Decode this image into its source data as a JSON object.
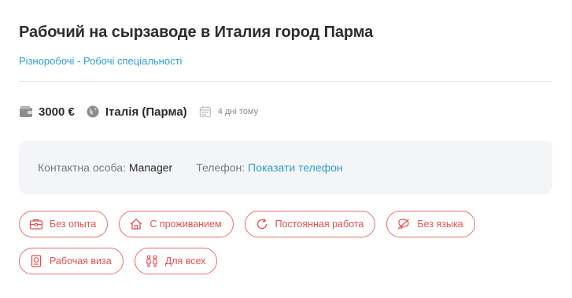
{
  "job": {
    "title": "Рабочий на сырзаводе в Италия город Парма",
    "category": "Різноробочі - Робочі спеціальності"
  },
  "meta": {
    "salary": "3000 €",
    "location": "Італія (Парма)",
    "posted": "4 дні тому",
    "icons": [
      "wallet-icon",
      "globe-icon",
      "calendar-icon"
    ]
  },
  "contact": {
    "person_label": "Контактна особа:",
    "person_value": "Manager",
    "phone_label": "Телефон:",
    "phone_link": "Показати телефон"
  },
  "tags": {
    "row1": [
      {
        "label": "Без опыта",
        "icon": "briefcase-icon"
      },
      {
        "label": "С проживанием",
        "icon": "house-icon"
      },
      {
        "label": "Постоянная работа",
        "icon": "refresh-icon"
      },
      {
        "label": "Без языка",
        "icon": "no-speech-icon"
      }
    ],
    "row2": [
      {
        "label": "Рабочая виза",
        "icon": "passport-icon"
      },
      {
        "label": "Для всех",
        "icon": "people-icon"
      }
    ]
  },
  "colors": {
    "accent_link": "#2f9fd1",
    "tag_red": "#e35151",
    "contact_bg": "#f4f5f7"
  }
}
